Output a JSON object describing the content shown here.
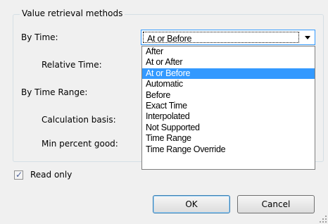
{
  "group": {
    "title": "Value retrieval methods"
  },
  "labels": {
    "by_time": "By Time:",
    "relative_time": "Relative Time:",
    "by_time_range": "By Time Range:",
    "calculation_basis": "Calculation basis:",
    "min_percent_good": "Min percent good:"
  },
  "combo": {
    "value": "At or Before"
  },
  "dropdown": {
    "options": [
      "After",
      "At or After",
      "At or Before",
      "Automatic",
      "Before",
      "Exact Time",
      "Interpolated",
      "Not Supported",
      "Time Range",
      "Time Range Override"
    ],
    "selected_index": 2
  },
  "read_only": {
    "label": "Read only",
    "checked": true
  },
  "buttons": {
    "ok": "OK",
    "cancel": "Cancel"
  },
  "colors": {
    "selection": "#3399ff",
    "focus_border": "#3399ff",
    "check": "#4a5f97"
  },
  "icons": {
    "combo_arrow": "chevron-down-icon",
    "checkmark": "checkmark-icon",
    "grip": "resize-grip-icon"
  }
}
